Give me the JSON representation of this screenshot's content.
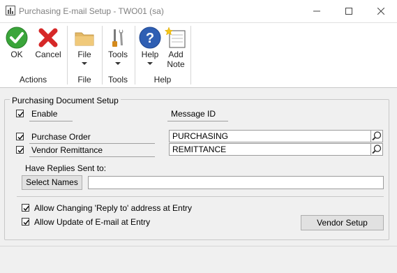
{
  "window": {
    "title": "Purchasing E-mail Setup  -  TWO01 (sa)"
  },
  "ribbon": {
    "groups": [
      {
        "label": "Actions",
        "buttons": [
          {
            "label": "OK"
          },
          {
            "label": "Cancel"
          }
        ]
      },
      {
        "label": "File",
        "buttons": [
          {
            "label": "File"
          }
        ]
      },
      {
        "label": "Tools",
        "buttons": [
          {
            "label": "Tools"
          }
        ]
      },
      {
        "label": "Help",
        "buttons": [
          {
            "label": "Help"
          },
          {
            "label": "Add",
            "label2": "Note"
          }
        ]
      }
    ]
  },
  "form": {
    "group_title": "Purchasing Document Setup",
    "enable": {
      "label": "Enable",
      "checked": true
    },
    "message_id_label": "Message ID",
    "purchase_order": {
      "label": "Purchase Order",
      "checked": true,
      "value": "PURCHASING"
    },
    "vendor_remittance": {
      "label": "Vendor Remittance",
      "checked": true,
      "value": "REMITTANCE"
    },
    "replies_label": "Have Replies Sent to:",
    "select_names_label": "Select Names",
    "replies_value": "",
    "allow_reply_to": {
      "label": "Allow Changing 'Reply to' address at Entry",
      "checked": true
    },
    "allow_update_email": {
      "label": "Allow Update of E-mail at Entry",
      "checked": true
    },
    "vendor_setup_label": "Vendor Setup"
  }
}
